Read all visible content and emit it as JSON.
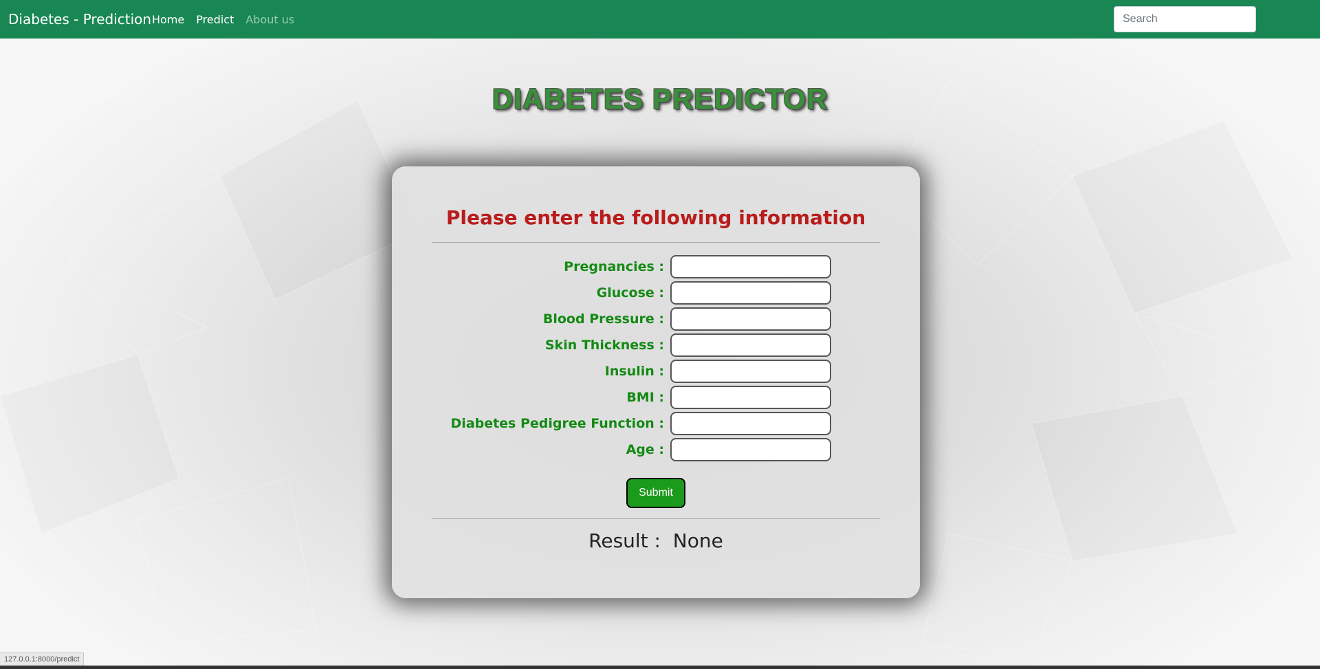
{
  "navbar": {
    "brand": "Diabetes - Prediction",
    "links": [
      "Home",
      "Predict",
      "About us"
    ],
    "search_placeholder": "Search",
    "color": "#198754"
  },
  "page_title": "DIABETES PREDICTOR",
  "form": {
    "heading": "Please enter the following information",
    "fields": [
      {
        "label": "Pregnancies :",
        "value": ""
      },
      {
        "label": "Glucose :",
        "value": ""
      },
      {
        "label": "Blood Pressure :",
        "value": ""
      },
      {
        "label": "Skin Thickness :",
        "value": ""
      },
      {
        "label": "Insulin :",
        "value": ""
      },
      {
        "label": "BMI :",
        "value": ""
      },
      {
        "label": "Diabetes Pedigree Function :",
        "value": ""
      },
      {
        "label": "Age :",
        "value": ""
      }
    ],
    "submit_label": "Submit"
  },
  "result": {
    "text": "Result :  None"
  },
  "status_url": "127.0.0.1:8000/predict",
  "colors": {
    "heading_red": "#b91c1c",
    "label_green": "#138a13",
    "submit_green": "#1c9a1c"
  }
}
